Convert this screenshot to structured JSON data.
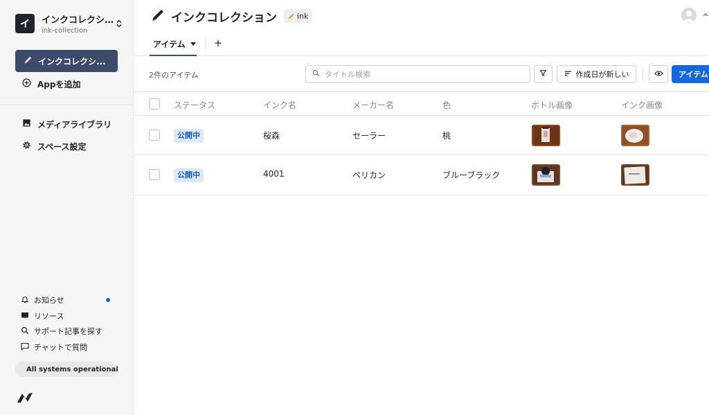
{
  "sidebar": {
    "space": {
      "initial": "イ",
      "name": "インクコレクシ...",
      "id": "ink-collection"
    },
    "nav_active": {
      "label": "インクコレクシ..."
    },
    "add_app": {
      "label": "Appを追加"
    },
    "media_library": {
      "label": "メディアライブラリ"
    },
    "space_settings": {
      "label": "スペース設定"
    },
    "footer": {
      "notifications": "お知らせ",
      "resources": "リソース",
      "search_support": "サポート記事を探す",
      "chat": "チャットで質問"
    },
    "status": {
      "label": "All systems operational",
      "color": "#27c38a"
    }
  },
  "header": {
    "title": "インクコレクション",
    "api_tag": "ink"
  },
  "tabs": {
    "active_label": "アイテム",
    "add_symbol": "+"
  },
  "toolbar": {
    "count": "2件のアイテム",
    "search_placeholder": "タイトル検索",
    "sort_label": "作成日が新しい",
    "primary_label": "アイテム"
  },
  "table": {
    "columns": [
      "ステータス",
      "インク名",
      "メーカー名",
      "色",
      "ボトル画像",
      "インク画像"
    ],
    "rows": [
      {
        "status": "公開中",
        "ink_name": "桜森",
        "maker": "セーラー",
        "color": "桃"
      },
      {
        "status": "公開中",
        "ink_name": "4001",
        "maker": "ペリカン",
        "color": "ブルーブラック"
      }
    ]
  },
  "colors": {
    "primary": "#1667dc",
    "nav_active": "#3d4a6b",
    "badge_bg": "#dbe9fb",
    "badge_text": "#1a5fbf"
  }
}
